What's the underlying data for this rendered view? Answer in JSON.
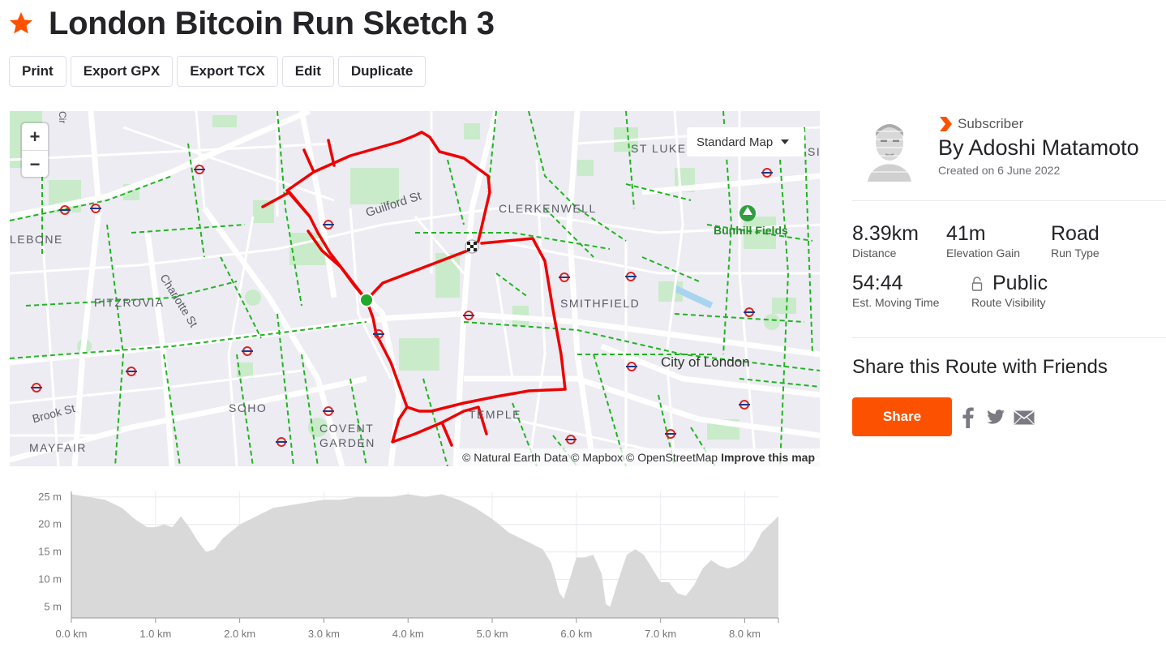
{
  "route": {
    "title": "London Bitcoin Run Sketch 3",
    "starred": true
  },
  "toolbar": {
    "print": "Print",
    "export_gpx": "Export GPX",
    "export_tcx": "Export TCX",
    "edit": "Edit",
    "duplicate": "Duplicate"
  },
  "map": {
    "style_selector": "Standard Map",
    "zoom_in": "+",
    "zoom_out": "−",
    "attribution": "© Natural Earth Data © Mapbox © OpenStreetMap",
    "improve_link": "Improve this map",
    "labels": {
      "lebone": "LEBONE",
      "fitzrovia": "FITZROVIA",
      "charlotte_st": "Charlotte St",
      "guilford_st": "Guilford St",
      "clerkenwell": "CLERKENWELL",
      "st_luke": "ST LUKE",
      "bunhill_fields": "Bunhill Fields",
      "smithfield": "SMITHFIELD",
      "city_of_london": "City of London",
      "soho": "SOHO",
      "brook_st": "Brook St",
      "mayfair": "MAYFAIR",
      "covent": "COVENT",
      "garden": "GARDEN",
      "temple": "TEMPLE",
      "si": "SI",
      "cir": "Cir"
    },
    "colors": {
      "route": "#ee0000",
      "park": "#c6eac6",
      "cycleway": "#1fb41f",
      "start": "#1faa2a"
    }
  },
  "athlete": {
    "badge": "Subscriber",
    "name": "By Adoshi Matamoto",
    "created": "Created on 6 June 2022"
  },
  "stats": {
    "distance": {
      "value": "8.39km",
      "label": "Distance"
    },
    "elevation": {
      "value": "41m",
      "label": "Elevation Gain"
    },
    "type": {
      "value": "Road",
      "label": "Run Type"
    },
    "time": {
      "value": "54:44",
      "label": "Est. Moving Time"
    },
    "visibility": {
      "value": "Public",
      "label": "Route Visibility"
    }
  },
  "share": {
    "heading": "Share this Route with Friends",
    "button": "Share",
    "facebook_icon": "facebook-icon",
    "twitter_icon": "twitter-icon",
    "email_icon": "email-icon"
  },
  "colors": {
    "brand": "#fc5200"
  },
  "chart_data": {
    "type": "area",
    "title": "",
    "xlabel": "",
    "ylabel": "",
    "x_unit": "km",
    "y_unit": "m",
    "xlim": [
      0,
      8.4
    ],
    "ylim": [
      3,
      26
    ],
    "x_ticks": [
      "0.0 km",
      "1.0 km",
      "2.0 km",
      "3.0 km",
      "4.0 km",
      "5.0 km",
      "6.0 km",
      "7.0 km",
      "8.0 km"
    ],
    "y_ticks": [
      "25 m",
      "20 m",
      "15 m",
      "10 m",
      "5 m"
    ],
    "x": [
      0.0,
      0.2,
      0.4,
      0.6,
      0.75,
      0.9,
      1.0,
      1.1,
      1.2,
      1.3,
      1.4,
      1.5,
      1.6,
      1.7,
      1.8,
      2.0,
      2.2,
      2.4,
      2.6,
      2.8,
      3.0,
      3.2,
      3.4,
      3.6,
      3.8,
      4.0,
      4.2,
      4.4,
      4.6,
      4.8,
      5.0,
      5.2,
      5.4,
      5.6,
      5.7,
      5.8,
      5.85,
      5.9,
      6.0,
      6.1,
      6.2,
      6.3,
      6.35,
      6.4,
      6.5,
      6.6,
      6.7,
      6.8,
      6.9,
      7.0,
      7.1,
      7.2,
      7.3,
      7.4,
      7.5,
      7.6,
      7.7,
      7.8,
      7.9,
      8.0,
      8.1,
      8.2,
      8.3,
      8.4
    ],
    "values": [
      25.5,
      25.0,
      24.5,
      23.0,
      21.0,
      19.5,
      19.5,
      20.0,
      19.5,
      21.5,
      19.5,
      17.0,
      15.0,
      15.5,
      17.5,
      20.0,
      21.5,
      23.0,
      23.5,
      24.0,
      24.5,
      24.5,
      25.0,
      25.0,
      25.0,
      25.5,
      25.0,
      25.5,
      24.5,
      23.0,
      21.0,
      18.5,
      17.0,
      15.5,
      13.0,
      7.5,
      6.5,
      9.0,
      14.0,
      14.0,
      14.5,
      11.0,
      5.5,
      5.0,
      10.0,
      14.5,
      15.5,
      14.5,
      12.0,
      9.5,
      9.5,
      7.5,
      7.0,
      9.0,
      12.0,
      13.5,
      12.5,
      12.0,
      12.5,
      13.5,
      15.5,
      18.5,
      20.0,
      21.5
    ]
  }
}
